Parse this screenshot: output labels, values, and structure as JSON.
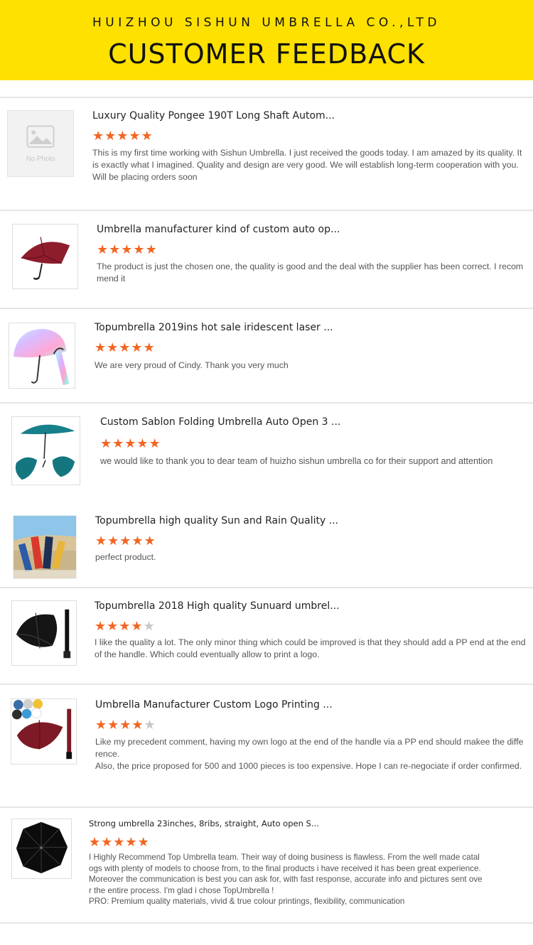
{
  "header": {
    "company": "HUIZHOU SISHUN UMBRELLA CO.,LTD",
    "title": "CUSTOMER FEEDBACK"
  },
  "colors": {
    "banner": "#ffe100",
    "star_filled": "#f26522",
    "star_empty": "#c8c8c8",
    "text": "#555555",
    "title": "#222222"
  },
  "reviews": [
    {
      "product": "Luxury Quality Pongee 190T Long Shaft Autom...",
      "rating": 5,
      "thumb_icon": "no-photo-icon",
      "thumb_label": "No Photo",
      "text": "This is my first time working with Sishun Umbrella. I just received the goods today. I am amazed by its quality. It is exactly what I imagined. Quality and design are very good. We will establish long-term cooperation with you. Will be placing orders soon"
    },
    {
      "product": "Umbrella manufacturer kind of custom auto op...",
      "rating": 5,
      "thumb_icon": "red-folding-umbrella-image",
      "text": "The product is just the chosen one, the quality is good and the deal with the supplier has been correct. I recommend it"
    },
    {
      "product": "Topumbrella 2019ins hot sale iridescent laser ...",
      "rating": 5,
      "thumb_icon": "iridescent-umbrella-image",
      "text": "We are very proud of Cindy. Thank you very much"
    },
    {
      "product": "Custom Sablon Folding Umbrella Auto Open 3 ...",
      "rating": 5,
      "thumb_icon": "teal-folding-umbrella-image",
      "text": "we would like to thank you to dear team of huizho sishun umbrella co for their support and attention"
    },
    {
      "product": "Topumbrella high quality Sun and Rain Quality ...",
      "rating": 5,
      "thumb_icon": "colorful-umbrellas-image",
      "text": "perfect product."
    },
    {
      "product": "Topumbrella 2018 High quality Sunuard umbrel...",
      "rating": 4,
      "thumb_icon": "black-golf-umbrella-image",
      "text": "I like the quality a lot. The only minor thing which could be improved is that they should add a PP end at the end of the handle. Which could eventually allow to print a logo."
    },
    {
      "product": "Umbrella Manufacturer Custom Logo Printing ...",
      "rating": 4,
      "thumb_icon": "burgundy-golf-umbrella-image",
      "text": "Like my precedent comment, having my own logo at the end of the handle via a PP end should makee the difference.",
      "text2": "Also, the price proposed for 500 and 1000 pieces is too expensive. Hope I can re-negociate if order confirmed."
    },
    {
      "product": "Strong umbrella 23inches, 8ribs, straight, Auto open S...",
      "rating": 5,
      "thumb_icon": "black-umbrella-top-view-image",
      "text": "I Highly Recommend Top Umbrella team. Their way of doing business is flawless. From the well made catalogs with plenty of models to choose from, to the final products i have received it has been great experience. Moreover the communication is best you can ask for, with fast response, accurate info and pictures sent over the entire process. I'm glad i chose TopUmbrella !",
      "text2": "PRO: Premium quality materials, vivid & true colour printings, flexibility, communication"
    }
  ]
}
